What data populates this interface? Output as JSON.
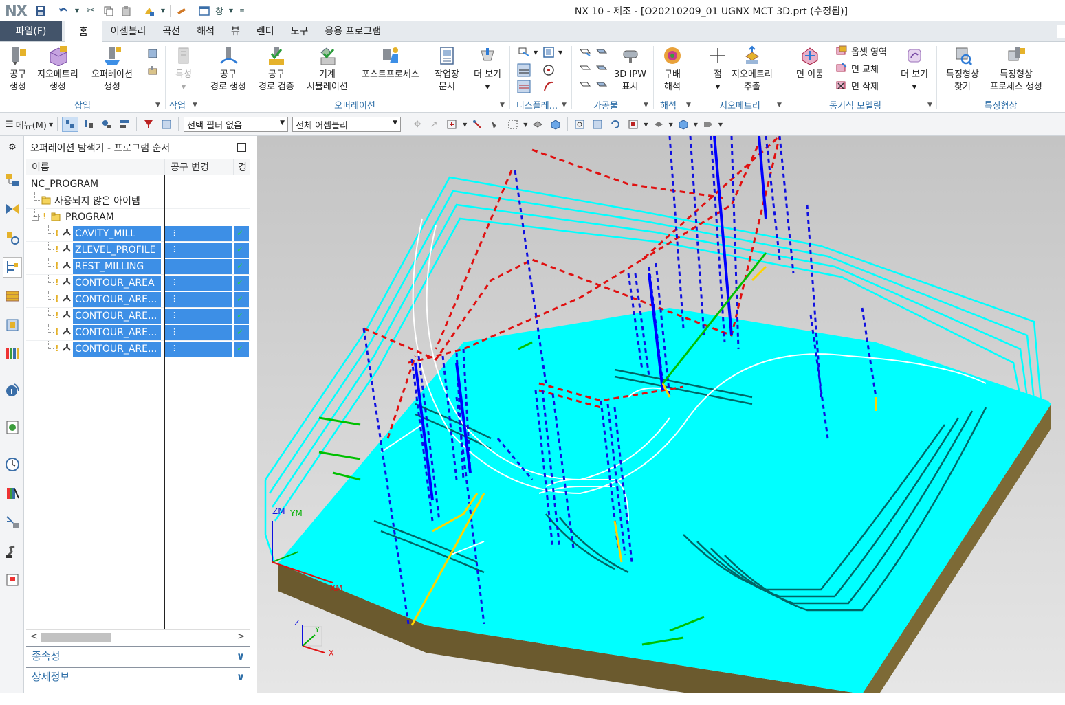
{
  "title_bar": {
    "logo": "NX",
    "window_title": "NX 10 - 제조 - [O20210209_01 UGNX MCT 3D.prt (수정됨)]",
    "window_menu": "창"
  },
  "menu": {
    "file": "파일(F)",
    "tabs": [
      "홈",
      "어셈블리",
      "곡선",
      "해석",
      "뷰",
      "렌더",
      "도구",
      "응용 프로그램"
    ],
    "active_tab": "홈"
  },
  "ribbon": {
    "buttons": {
      "create_tool": [
        "공구",
        "생성"
      ],
      "create_geometry": [
        "지오메트리",
        "생성"
      ],
      "create_operation": [
        "오퍼레이션",
        "생성"
      ],
      "feature": [
        "특성"
      ],
      "gen_toolpath": [
        "공구",
        "경로 생성"
      ],
      "verify_toolpath": [
        "공구",
        "경로 검증"
      ],
      "machine_sim": [
        "기계",
        "시뮬레이션"
      ],
      "postprocess": [
        "포스트프로세스"
      ],
      "shop_doc": [
        "작업장",
        "문서"
      ],
      "more_view": [
        "더 보기"
      ],
      "ipw": [
        "3D IPW",
        "표시"
      ],
      "gradient": [
        "구배",
        "해석"
      ],
      "point": [
        "점"
      ],
      "extract_geom": [
        "지오메트리",
        "추출"
      ],
      "move_face": [
        "면 이동"
      ],
      "offset_region": "옵셋 영역",
      "replace_face": "면 교체",
      "delete_face": "면 삭제",
      "more_sync": [
        "더 보기"
      ],
      "find_feature": [
        "특징형상",
        "찾기"
      ],
      "feature_process": [
        "특징형상",
        "프로세스 생성"
      ]
    },
    "groups": [
      "삽입",
      "작업",
      "오퍼레이션",
      "디스플레...",
      "가공물",
      "해석",
      "지오메트리",
      "동기식 모델링",
      "특징형상"
    ]
  },
  "command_bar": {
    "menu_label": "메뉴(M)",
    "selection_filter": "선택 필터 없음",
    "assembly_scope": "전체 어셈블리"
  },
  "navigator": {
    "title": "오퍼레이션 탐색기 - 프로그램 순서",
    "columns": [
      "이름",
      "공구 변경",
      "경"
    ],
    "tree": [
      {
        "name": "NC_PROGRAM",
        "level": 0,
        "selected": false
      },
      {
        "name": "사용되지 않은 아이템",
        "level": 1,
        "selected": false
      },
      {
        "name": "PROGRAM",
        "level": 1,
        "selected": false
      },
      {
        "name": "CAVITY_MILL",
        "level": 2,
        "selected": true
      },
      {
        "name": "ZLEVEL_PROFILE",
        "level": 2,
        "selected": true
      },
      {
        "name": "REST_MILLING",
        "level": 2,
        "selected": true
      },
      {
        "name": "CONTOUR_AREA",
        "level": 2,
        "selected": true
      },
      {
        "name": "CONTOUR_ARE...",
        "level": 2,
        "selected": true
      },
      {
        "name": "CONTOUR_ARE...",
        "level": 2,
        "selected": true
      },
      {
        "name": "CONTOUR_ARE...",
        "level": 2,
        "selected": true
      },
      {
        "name": "CONTOUR_ARE...",
        "level": 2,
        "selected": true
      }
    ],
    "panels": [
      "종속성",
      "상세정보"
    ]
  },
  "viewport": {
    "axis_labels": {
      "zm": "ZM",
      "ym": "YM",
      "xm": "XM",
      "z": "Z",
      "y": "Y",
      "x": "X"
    }
  },
  "colors": {
    "file_tab": "#43546a",
    "selection": "#3d8fe6",
    "accent_blue": "#2d6ea7",
    "cyan_stock": "#00ffff",
    "base_brown": "#6b5a2e"
  }
}
